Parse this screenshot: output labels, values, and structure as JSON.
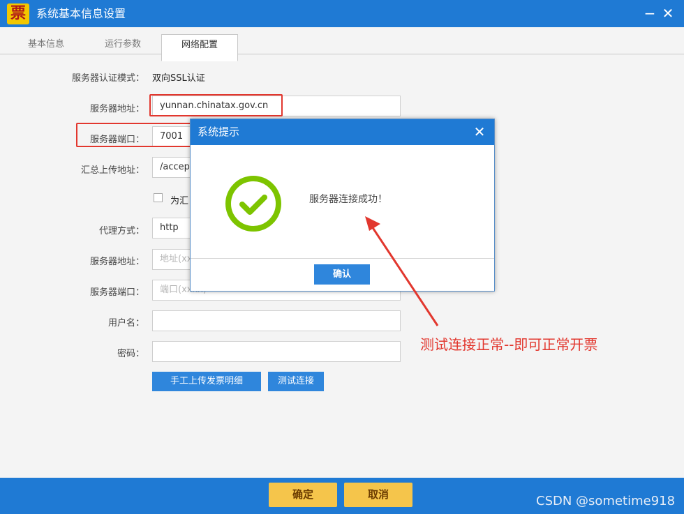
{
  "window": {
    "logo_char": "票",
    "title": "系统基本信息设置",
    "minimize": "−",
    "close": "✕"
  },
  "tabs": [
    {
      "label": "基本信息"
    },
    {
      "label": "运行参数"
    },
    {
      "label": "网络配置",
      "active": true
    }
  ],
  "form": {
    "auth_mode_label": "服务器认证模式：",
    "auth_mode_value": "双向SSL认证",
    "server_address_label": "服务器地址：",
    "server_address_value": "yunnan.chinatax.gov.cn",
    "server_port_label": "服务器端口：",
    "server_port_value": "7001",
    "upload_address_label": "汇总上传地址：",
    "upload_address_value": "/accep",
    "checkbox_label": "为汇",
    "proxy_mode_label": "代理方式：",
    "proxy_mode_value": "http",
    "proxy_address_label": "服务器地址：",
    "proxy_address_placeholder": "地址(xx",
    "proxy_port_label": "服务器端口：",
    "proxy_port_placeholder": "端口(xxxx)",
    "username_label": "用户名：",
    "username_value": "",
    "password_label": "密码：",
    "password_value": "",
    "manual_upload_button": "手工上传发票明细",
    "test_connection_button": "测试连接"
  },
  "footer": {
    "ok_button": "确定",
    "cancel_button": "取消",
    "watermark": "CSDN @sometime918"
  },
  "dialog": {
    "title": "系统提示",
    "close": "✕",
    "message": "服务器连接成功！",
    "ok_button": "确认",
    "icon": "check-circle-icon",
    "icon_color": "#7dc400"
  },
  "annotation": {
    "text": "测试连接正常--即可正常开票",
    "color": "#e2372e"
  },
  "colors": {
    "titlebar": "#1f7ad4",
    "button_blue": "#2f86dc",
    "button_yellow": "#f5c54b"
  }
}
